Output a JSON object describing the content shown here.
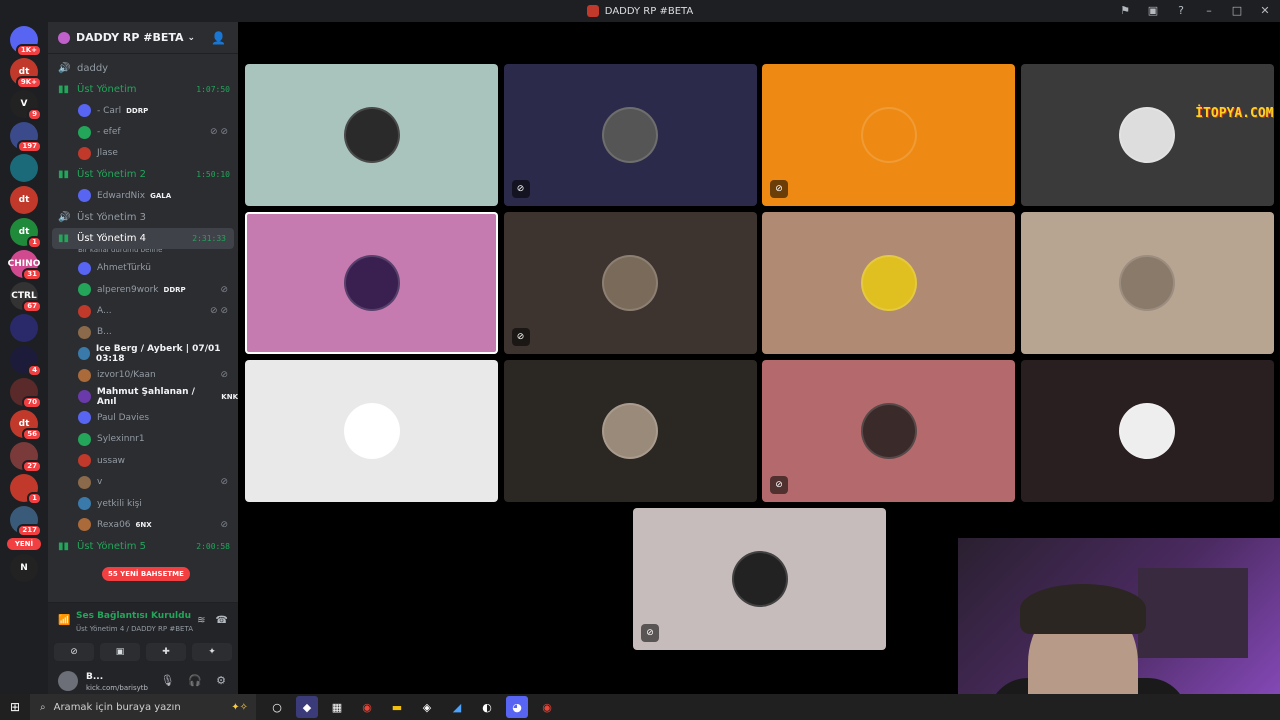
{
  "window": {
    "title": "DADDY RP #BETA",
    "controls": [
      "flag-icon",
      "inbox-icon",
      "help-icon",
      "minimize-icon",
      "maximize-icon",
      "close-icon"
    ]
  },
  "rail": {
    "servers": [
      {
        "badge": "1K+",
        "color": "#5865f2",
        "label": ""
      },
      {
        "badge": "9K+",
        "color": "#c0392b",
        "label": "dt"
      },
      {
        "badge": "9",
        "color": "#222",
        "label": "V"
      },
      {
        "badge": "197",
        "color": "#3b4a8a",
        "label": ""
      },
      {
        "badge": "",
        "color": "#1b6a7a",
        "label": ""
      },
      {
        "badge": "",
        "color": "#c0392b",
        "label": "dt"
      },
      {
        "badge": "1",
        "color": "#1f8b3a",
        "label": "dt"
      },
      {
        "badge": "31",
        "color": "#d14a90",
        "label": "CHINO"
      },
      {
        "badge": "67",
        "color": "#333",
        "label": "CTRL"
      },
      {
        "badge": "",
        "color": "#2a2a6a",
        "label": ""
      },
      {
        "badge": "4",
        "color": "#1c1c3a",
        "label": ""
      },
      {
        "badge": "70",
        "color": "#5a2a2a",
        "label": ""
      },
      {
        "badge": "56",
        "color": "#c0392b",
        "label": "dt"
      },
      {
        "badge": "27",
        "color": "#7a3a3a",
        "label": ""
      },
      {
        "badge": "1",
        "color": "#c0392b",
        "label": ""
      },
      {
        "badge": "217",
        "color": "#3a5a7a",
        "label": ""
      },
      {
        "badge": "",
        "color": "#222",
        "label": "N"
      }
    ],
    "new_label": "YENİ"
  },
  "guild": {
    "name": "DADDY RP #BETA"
  },
  "channels": {
    "items": [
      {
        "name": "daddy",
        "timer": "",
        "active": false
      },
      {
        "name": "Üst Yönetim",
        "timer": "1:07:50",
        "active": true
      }
    ],
    "group1_users": [
      {
        "name": "- Carl",
        "tag": "DDRP",
        "mute": ""
      },
      {
        "name": "- efef",
        "tag": "",
        "mute": "⊘ ⊘"
      },
      {
        "name": "Jlase",
        "tag": "",
        "mute": ""
      }
    ],
    "ch2": {
      "name": "Üst Yönetim 2",
      "timer": "1:50:10"
    },
    "group2_users": [
      {
        "name": "EdwardNix",
        "tag": "GALA",
        "mute": ""
      }
    ],
    "ch3": {
      "name": "Üst Yönetim 3"
    },
    "ch4": {
      "name": "Üst Yönetim 4",
      "timer": "2:31:33",
      "status": "Bir kanal durumu belirle"
    },
    "group4_users": [
      {
        "name": "AhmetTürkü",
        "tag": "",
        "mute": "",
        "bright": false
      },
      {
        "name": "alperen9work",
        "tag": "DDRP",
        "mute": "⊘",
        "bright": false
      },
      {
        "name": "A...",
        "tag": "",
        "mute": "⊘ ⊘",
        "bright": false
      },
      {
        "name": "B...",
        "tag": "",
        "mute": "",
        "bright": false
      },
      {
        "name": "Ice Berg / Ayberk | 07/01 03:18",
        "tag": "",
        "mute": "",
        "bright": true
      },
      {
        "name": "izvor10/Kaan",
        "tag": "",
        "mute": "⊘",
        "bright": false
      },
      {
        "name": "Mahmut Şahlanan / Anıl",
        "tag": "KNK",
        "mute": "",
        "bright": true
      },
      {
        "name": "Paul Davies",
        "tag": "",
        "mute": "",
        "bright": false
      },
      {
        "name": "Sylexinnr1",
        "tag": "",
        "mute": "",
        "bright": false
      },
      {
        "name": "ussaw",
        "tag": "",
        "mute": "",
        "bright": false
      },
      {
        "name": "v",
        "tag": "",
        "mute": "⊘",
        "bright": false
      },
      {
        "name": "yetkili kişi",
        "tag": "",
        "mute": "",
        "bright": false
      },
      {
        "name": "Rexa06",
        "tag": "6NX",
        "mute": "⊘",
        "bright": false
      }
    ],
    "ch5": {
      "name": "Üst Yönetim 5",
      "timer": "2:00:58"
    },
    "mention_pill": "55 YENİ BAHSETME"
  },
  "voice": {
    "status": "Ses Bağlantısı Kuruldu",
    "location": "Üst Yönetim 4 / DADDY RP #BETA"
  },
  "user_panel": {
    "name": "B...",
    "status": "kick.com/barisytb"
  },
  "stage": {
    "watermark": "İTOPYA.COM",
    "tiles": [
      {
        "bg": "#a9c3bd",
        "muted": false,
        "avatar": "#2a2a2a"
      },
      {
        "bg": "#2c2a4a",
        "muted": true,
        "avatar": "#555"
      },
      {
        "bg": "#ee8a13",
        "muted": true,
        "avatar": "#ee8a13"
      },
      {
        "bg": "#3a3a3a",
        "muted": false,
        "avatar": "#ddd"
      },
      {
        "bg": "#c57ab0",
        "muted": false,
        "avatar": "#3a2050"
      },
      {
        "bg": "#3d3430",
        "muted": true,
        "avatar": "#7a6a5a"
      },
      {
        "bg": "#b08a72",
        "muted": false,
        "avatar": "#e0c020"
      },
      {
        "bg": "#b7a591",
        "muted": false,
        "avatar": "#8a7a6a"
      },
      {
        "bg": "#e9e9e9",
        "muted": false,
        "avatar": "#fff"
      },
      {
        "bg": "#2b2723",
        "muted": false,
        "avatar": "#9a8a7a"
      },
      {
        "bg": "#b46a6c",
        "muted": true,
        "avatar": "#3a2a2a"
      },
      {
        "bg": "#291e20",
        "muted": false,
        "avatar": "#eee"
      },
      {
        "bg": "#c7bcbc",
        "muted": true,
        "avatar": "#222"
      }
    ]
  },
  "taskbar": {
    "search_placeholder": "Aramak için buraya yazın"
  }
}
